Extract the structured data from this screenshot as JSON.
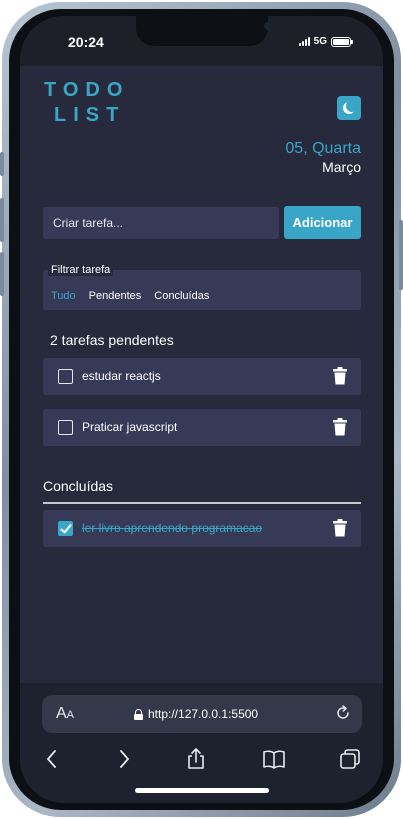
{
  "status_bar": {
    "time": "20:24",
    "network": "5G"
  },
  "app": {
    "logo_line1": "TODO",
    "logo_line2": "LIST",
    "date_line1": "05, Quarta",
    "date_line2": "Março",
    "input_placeholder": "Criar tarefa...",
    "add_button": "Adicionar",
    "filter": {
      "legend": "Filtrar tarefa",
      "tabs": [
        "Tudo",
        "Pendentes",
        "Concluídas"
      ],
      "active": "Tudo"
    },
    "pending_title": "2 tarefas pendentes",
    "pending_tasks": [
      {
        "text": "estudar reactjs",
        "done": false
      },
      {
        "text": "Praticar javascript",
        "done": false
      }
    ],
    "done_title": "Concluídas",
    "done_tasks": [
      {
        "text": "ler livro aprendendo programacao",
        "done": true
      }
    ]
  },
  "browser": {
    "text_size_label": "A",
    "text_size_small": "A",
    "url": "http://127.0.0.1:5500"
  },
  "colors": {
    "accent": "#3aa6c7",
    "background": "#272a3d",
    "card": "#373a56"
  },
  "icons": [
    "moon-icon",
    "trash-icon",
    "lock-icon",
    "reload-icon",
    "back-icon",
    "forward-icon",
    "share-icon",
    "bookmarks-icon",
    "tabs-icon"
  ]
}
